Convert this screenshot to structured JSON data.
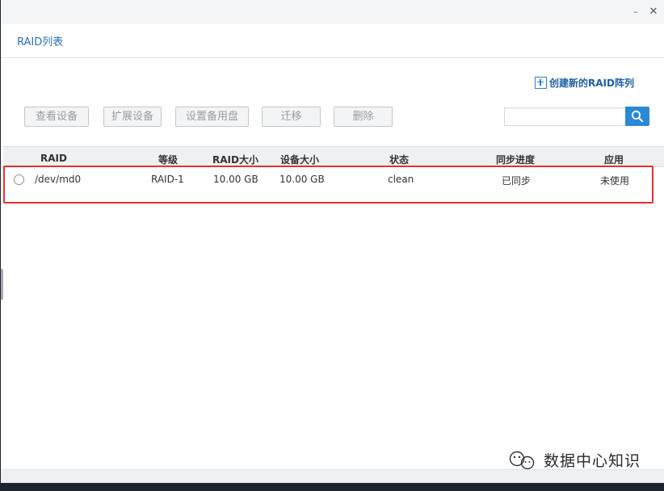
{
  "window": {
    "minimize_glyph": "–",
    "close_glyph": "✕"
  },
  "header": {
    "title": "RAID列表"
  },
  "actions": {
    "create_label": "创建新的RAID阵列"
  },
  "toolbar": {
    "view_device": "查看设备",
    "expand_device": "扩展设备",
    "set_spare": "设置备用盘",
    "migrate": "迁移",
    "delete": "删除"
  },
  "search": {
    "value": "",
    "placeholder": ""
  },
  "table": {
    "headers": {
      "raid": "RAID",
      "level": "等级",
      "raid_size": "RAID大小",
      "device_size": "设备大小",
      "status": "状态",
      "sync_progress": "同步进度",
      "application": "应用"
    },
    "rows": [
      {
        "raid": "/dev/md0",
        "level": "RAID-1",
        "raid_size": "10.00 GB",
        "device_size": "10.00 GB",
        "status": "clean",
        "sync_progress": "已同步",
        "application": "未使用"
      }
    ]
  },
  "watermark": {
    "text": "数据中心知识"
  },
  "colors": {
    "accent": "#2a88d8",
    "link": "#1e5fa8",
    "highlight": "#e8302a"
  },
  "icons": {
    "create": "plus-square-icon",
    "search": "search-icon",
    "watermark": "wechat-icon"
  }
}
